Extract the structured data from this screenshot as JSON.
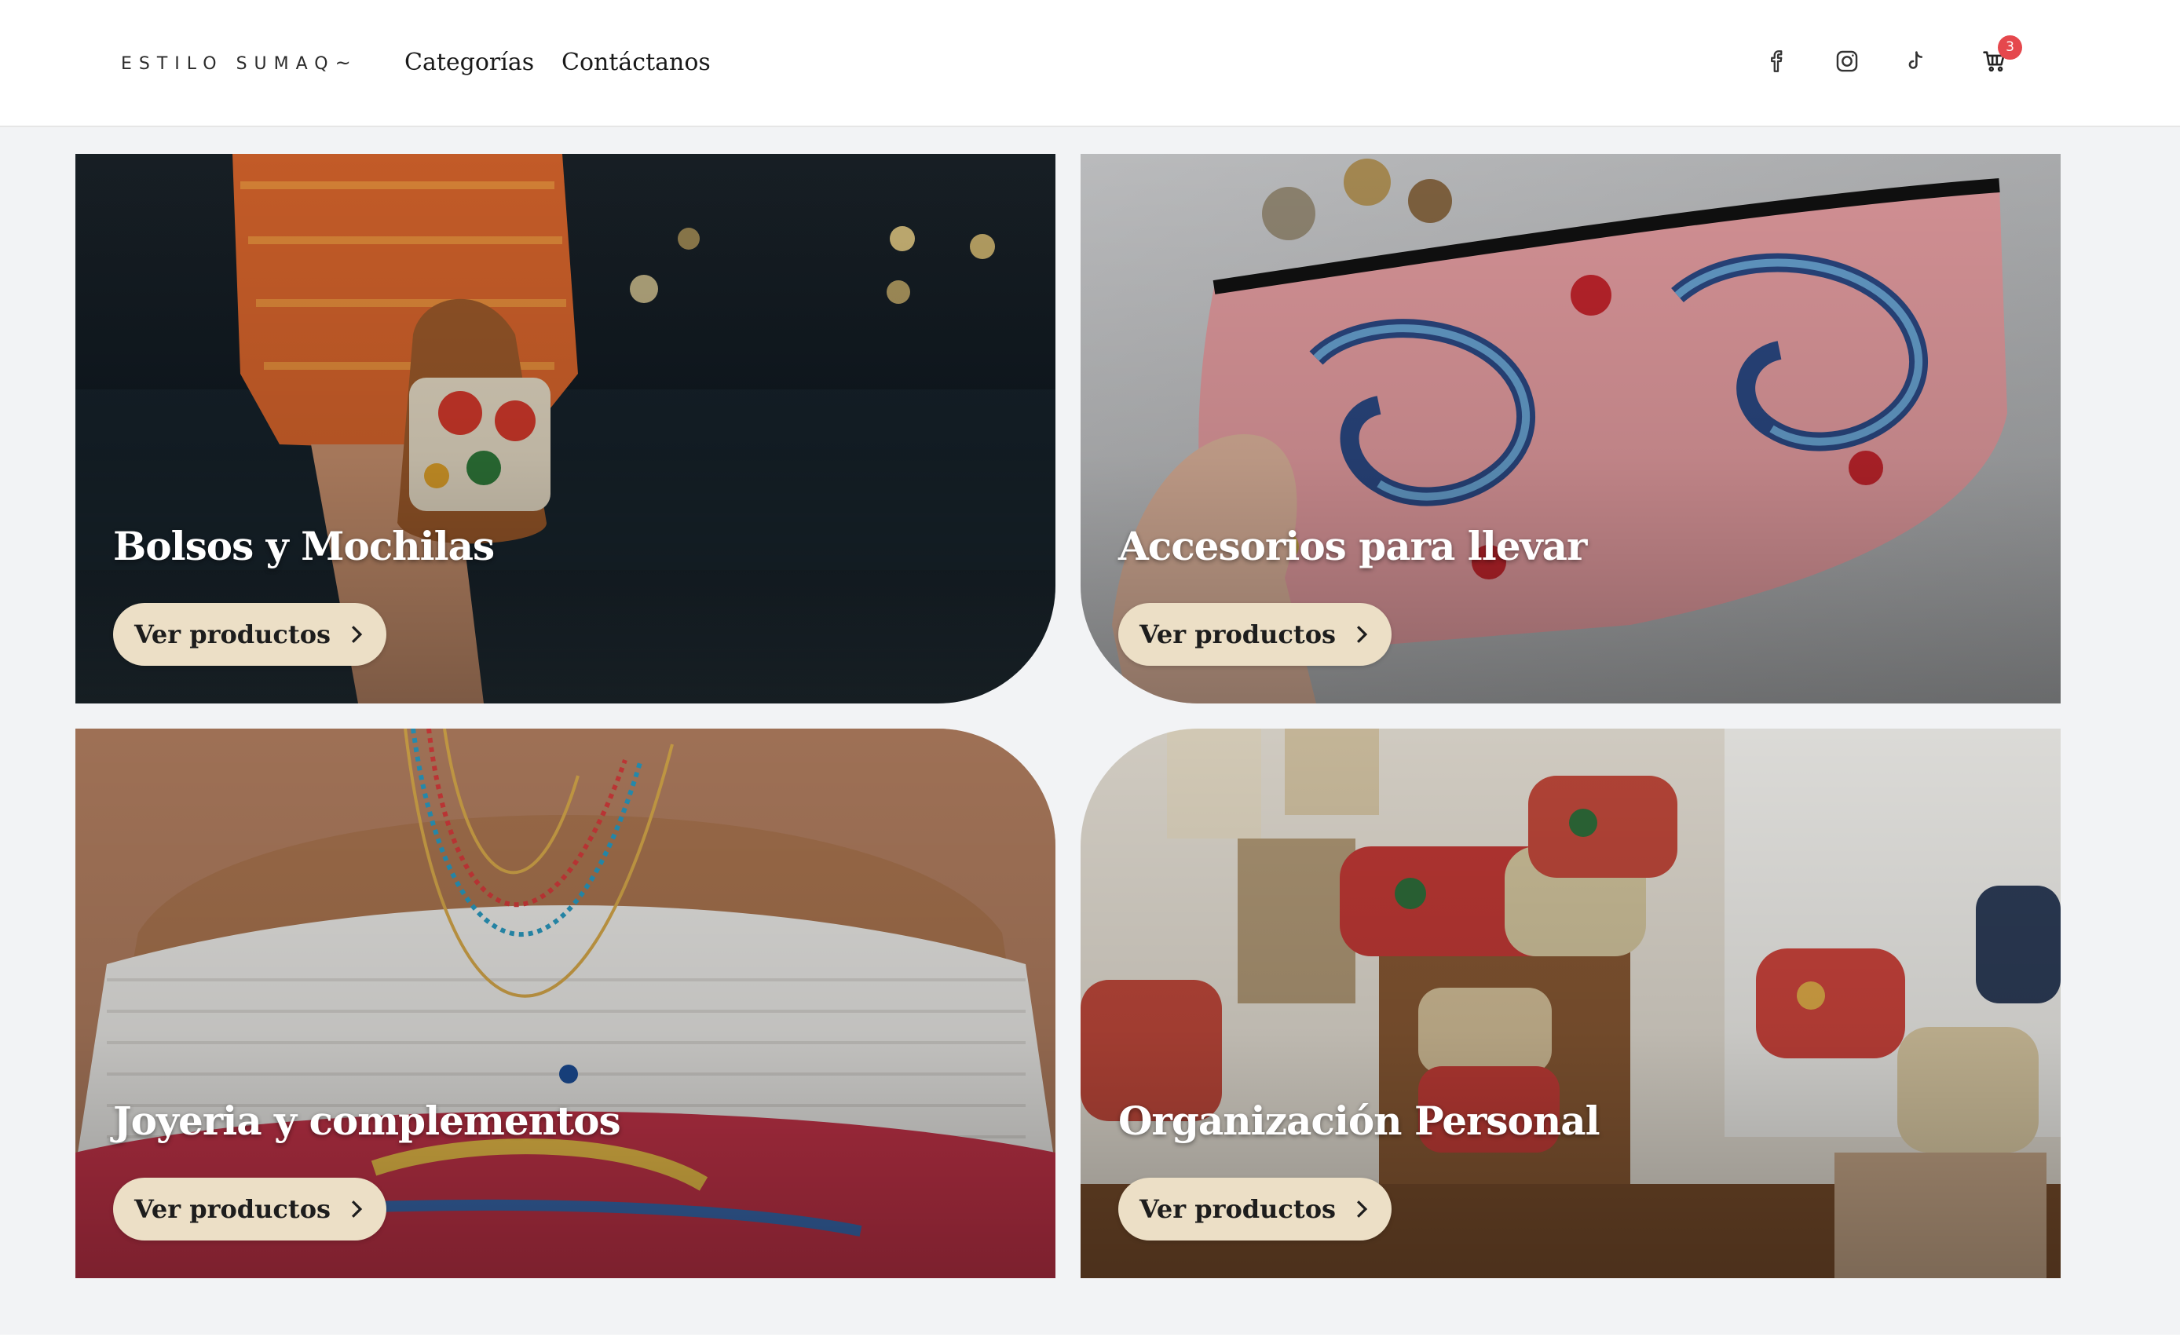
{
  "brand": {
    "logo_text": "ESTILO SUMAQ"
  },
  "nav": {
    "categories_label": "Categorías",
    "contact_label": "Contáctanos"
  },
  "social_icons": [
    "facebook-icon",
    "instagram-icon",
    "tiktok-icon"
  ],
  "cart": {
    "icon": "shopping-cart-icon",
    "count": "3"
  },
  "categories": [
    {
      "title": "Bolsos y Mochilas",
      "button_label": "Ver productos",
      "image": "woman in crochet dress holding embroidered bucket bag at night"
    },
    {
      "title": "Accesorios para llevar",
      "button_label": "Ver productos",
      "image": "hand holding pink paisley embroidered zip pouch"
    },
    {
      "title": "Joyeria y complementos",
      "button_label": "Ver productos",
      "image": "layered beaded necklaces on off-shoulder white top"
    },
    {
      "title": "Organización Personal",
      "button_label": "Ver productos",
      "image": "shelves of floral embroidered coin purses and pouches"
    }
  ],
  "colors": {
    "page_background": "#f2f3f5",
    "button_background": "#ecdfc6",
    "badge": "#e5484d",
    "title_text": "#ffffff"
  }
}
